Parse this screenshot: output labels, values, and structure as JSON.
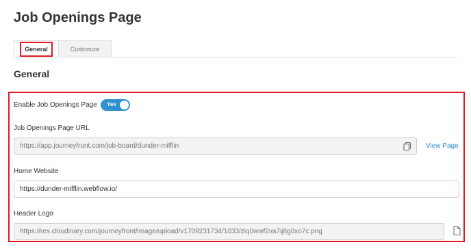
{
  "page": {
    "title": "Job Openings Page"
  },
  "tabs": [
    {
      "label": "General",
      "active": true
    },
    {
      "label": "Customize",
      "active": false
    }
  ],
  "section": {
    "title": "General"
  },
  "enable": {
    "label": "Enable Job Openings Page",
    "toggle_label": "Yes",
    "on": true
  },
  "url_field": {
    "label": "Job Openings Page URL",
    "value": "https://app.journeyfront.com/job-board/dunder-mifflin",
    "copy_icon": "copy-icon",
    "view_link": "View Page"
  },
  "home_website": {
    "label": "Home Website",
    "value": "https://dunder-mifflin.webflow.io/"
  },
  "header_logo": {
    "label": "Header Logo",
    "value": "https://res.cloudinary.com/journeyfront/image/upload/v1709231734/1033/ziq0wwf2va7ij8g0xo7c.png",
    "file_icon": "file-icon"
  },
  "colors": {
    "accent": "#2f8fd0",
    "highlight": "#e0191f",
    "readonly_bg": "#f3f3f3"
  }
}
